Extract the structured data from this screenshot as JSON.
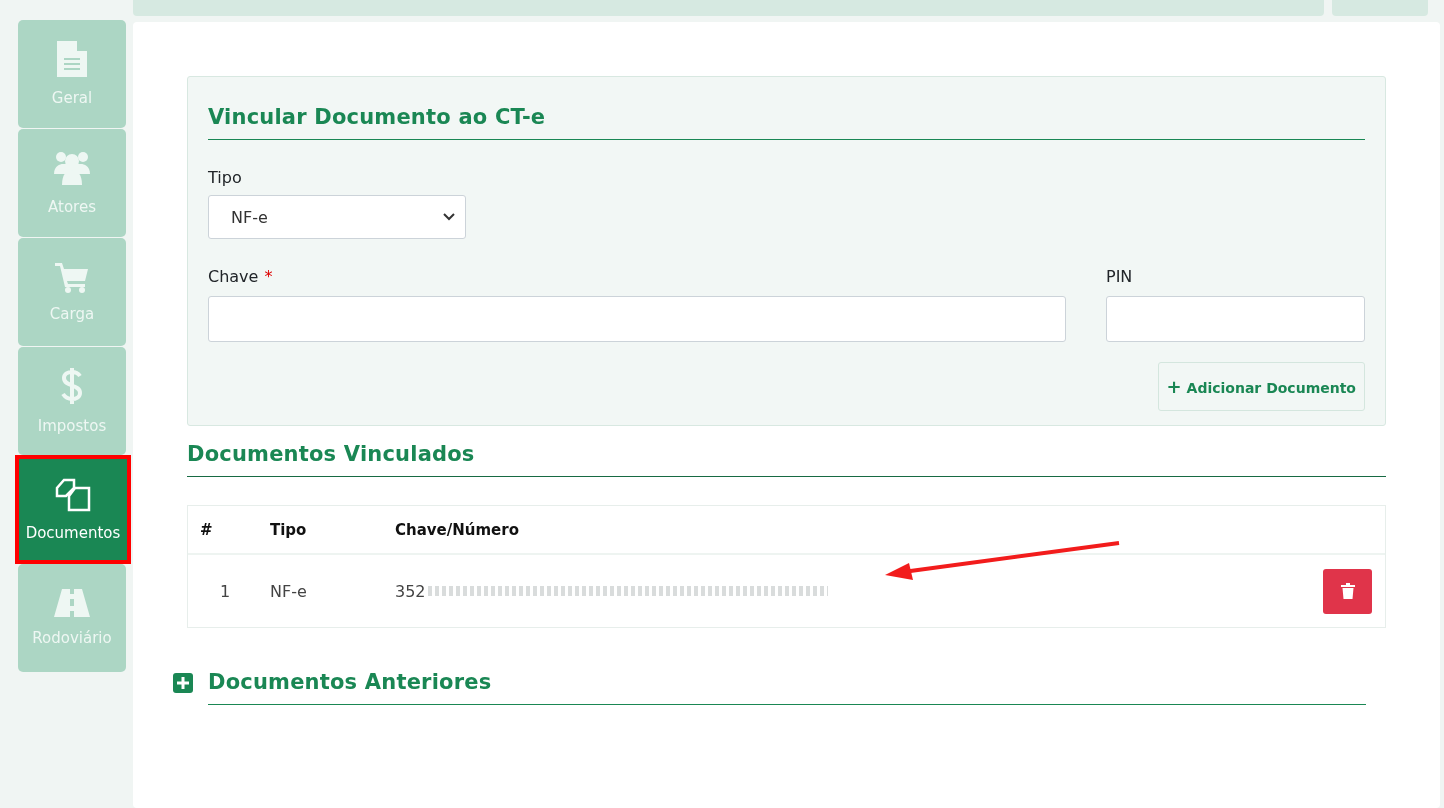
{
  "sidebar": {
    "items": [
      {
        "label": "Geral",
        "kind": "file",
        "selected": false,
        "highlighted": false
      },
      {
        "label": "Atores",
        "kind": "users",
        "selected": false,
        "highlighted": false
      },
      {
        "label": "Carga",
        "kind": "cart",
        "selected": false,
        "highlighted": false
      },
      {
        "label": "Impostos",
        "kind": "dollar",
        "selected": false,
        "highlighted": false
      },
      {
        "label": "Documentos",
        "kind": "copy",
        "selected": true,
        "highlighted": true
      },
      {
        "label": "Rodoviário",
        "kind": "road",
        "selected": false,
        "highlighted": false
      }
    ]
  },
  "form": {
    "title": "Vincular Documento ao CT-e",
    "tipo": {
      "label": "Tipo",
      "value": "NF-e"
    },
    "chave": {
      "label": "Chave",
      "required_mark": "*"
    },
    "pin": {
      "label": "PIN"
    },
    "add_button": {
      "icon": "+",
      "label": "Adicionar Documento"
    }
  },
  "linked": {
    "title": "Documentos Vinculados",
    "table": {
      "columns": [
        "#",
        "Tipo",
        "Chave/Número"
      ],
      "rows": [
        {
          "index": "1",
          "tipo": "NF-e",
          "chave": "352",
          "redacted": true,
          "pointed": true
        }
      ]
    }
  },
  "previous": {
    "title": "Documentos Anteriores"
  }
}
